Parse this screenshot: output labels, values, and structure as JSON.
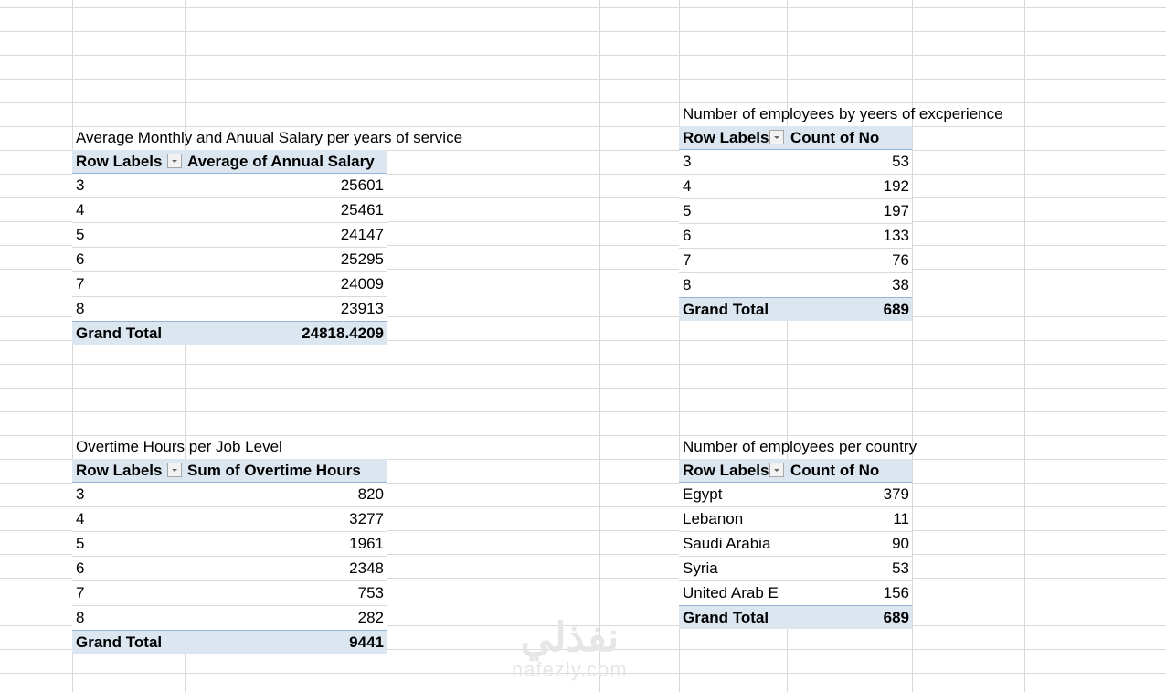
{
  "pivots": [
    {
      "title": "Average Monthly and Anuual Salary per years of service",
      "row_header": "Row Labels",
      "value_header": "Average of Annual Salary",
      "rows": [
        {
          "label": "3",
          "value": "25601"
        },
        {
          "label": "4",
          "value": "25461"
        },
        {
          "label": "5",
          "value": "24147"
        },
        {
          "label": "6",
          "value": "25295"
        },
        {
          "label": "7",
          "value": "24009"
        },
        {
          "label": "8",
          "value": "23913"
        }
      ],
      "total_label": "Grand Total",
      "total_value": "24818.4209"
    },
    {
      "title": "Number of employees by yeers of excperience",
      "row_header": "Row Labels",
      "value_header": "Count of No",
      "rows": [
        {
          "label": "3",
          "value": "53"
        },
        {
          "label": "4",
          "value": "192"
        },
        {
          "label": "5",
          "value": "197"
        },
        {
          "label": "6",
          "value": "133"
        },
        {
          "label": "7",
          "value": "76"
        },
        {
          "label": "8",
          "value": "38"
        }
      ],
      "total_label": "Grand Total",
      "total_value": "689"
    },
    {
      "title": "Overtime Hours per Job Level",
      "row_header": "Row Labels",
      "value_header": "Sum of Overtime Hours",
      "rows": [
        {
          "label": "3",
          "value": "820"
        },
        {
          "label": "4",
          "value": "3277"
        },
        {
          "label": "5",
          "value": "1961"
        },
        {
          "label": "6",
          "value": "2348"
        },
        {
          "label": "7",
          "value": "753"
        },
        {
          "label": "8",
          "value": "282"
        }
      ],
      "total_label": "Grand Total",
      "total_value": "9441"
    },
    {
      "title": "Number of employees per country",
      "row_header": "Row Labels",
      "value_header": "Count of No",
      "rows": [
        {
          "label": "Egypt",
          "value": "379"
        },
        {
          "label": "Lebanon",
          "value": "11"
        },
        {
          "label": "Saudi Arabia",
          "value": "90"
        },
        {
          "label": "Syria",
          "value": "53"
        },
        {
          "label": "United Arab E",
          "value": "156"
        }
      ],
      "total_label": "Grand Total",
      "total_value": "689"
    }
  ],
  "watermark": {
    "arabic": "نفذلي",
    "latin": "nafezly.com"
  }
}
